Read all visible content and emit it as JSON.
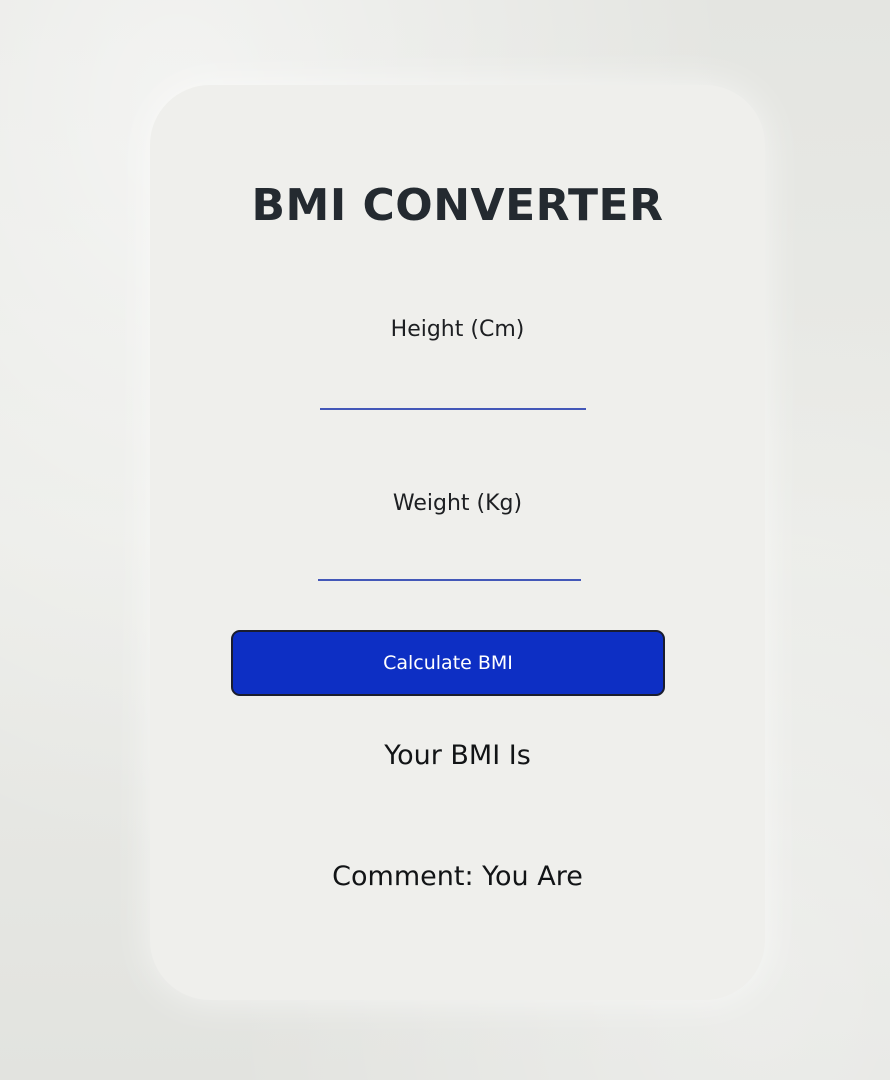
{
  "app": {
    "title": "BMI CONVERTER"
  },
  "form": {
    "height_label": "Height (Cm)",
    "height_value": "",
    "weight_label": "Weight (Kg)",
    "weight_value": "",
    "calculate_label": "Calculate BMI"
  },
  "result": {
    "bmi_text": "Your BMI Is",
    "comment_text": "Comment: You Are"
  },
  "colors": {
    "button": "#0d2fc4",
    "input_underline": "#4357b8",
    "title": "#242a30"
  }
}
